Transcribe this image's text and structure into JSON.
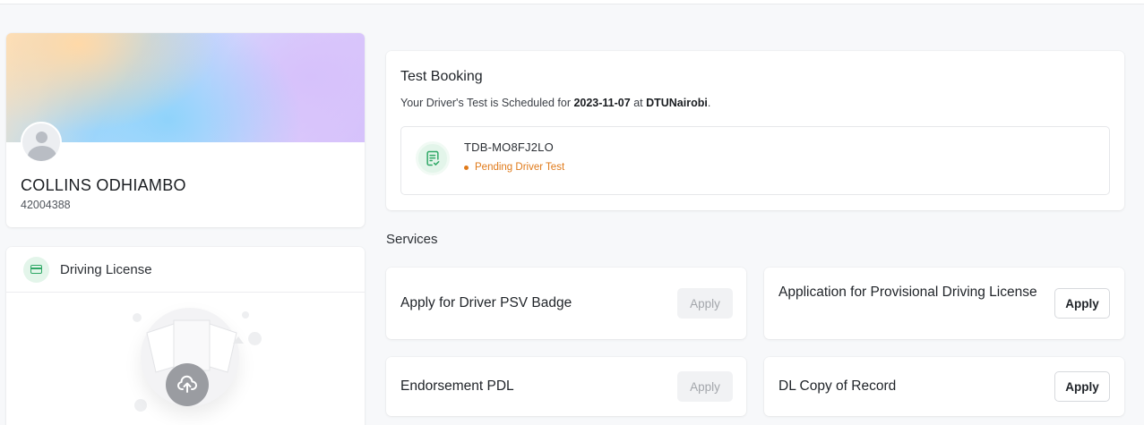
{
  "profile": {
    "name": "COLLINS ODHIAMBO",
    "id_number": "42004388"
  },
  "license_card": {
    "title": "Driving License"
  },
  "test_booking": {
    "title": "Test Booking",
    "text_prefix": "Your Driver's Test is Scheduled for ",
    "date": "2023-11-07",
    "text_mid": " at ",
    "location": "DTUNairobi",
    "text_suffix": ".",
    "reference": "TDB-MO8FJ2LO",
    "status": "Pending Driver Test",
    "status_color": "#e07a1a"
  },
  "services": {
    "title": "Services",
    "items": [
      {
        "label": "Apply for Driver PSV Badge",
        "button": "Apply",
        "enabled": false
      },
      {
        "label": "Application for Provisional Driving License",
        "button": "Apply",
        "enabled": true
      },
      {
        "label": "Endorsement PDL",
        "button": "Apply",
        "enabled": false
      },
      {
        "label": "DL Copy of Record",
        "button": "Apply",
        "enabled": true
      }
    ]
  },
  "icons": {
    "avatar": "user-avatar-icon",
    "license": "credit-card-icon",
    "document": "document-check-icon",
    "upload": "upload-arrow-icon"
  },
  "colors": {
    "accent_green": "#2fa866",
    "background": "#f7f8fa"
  }
}
